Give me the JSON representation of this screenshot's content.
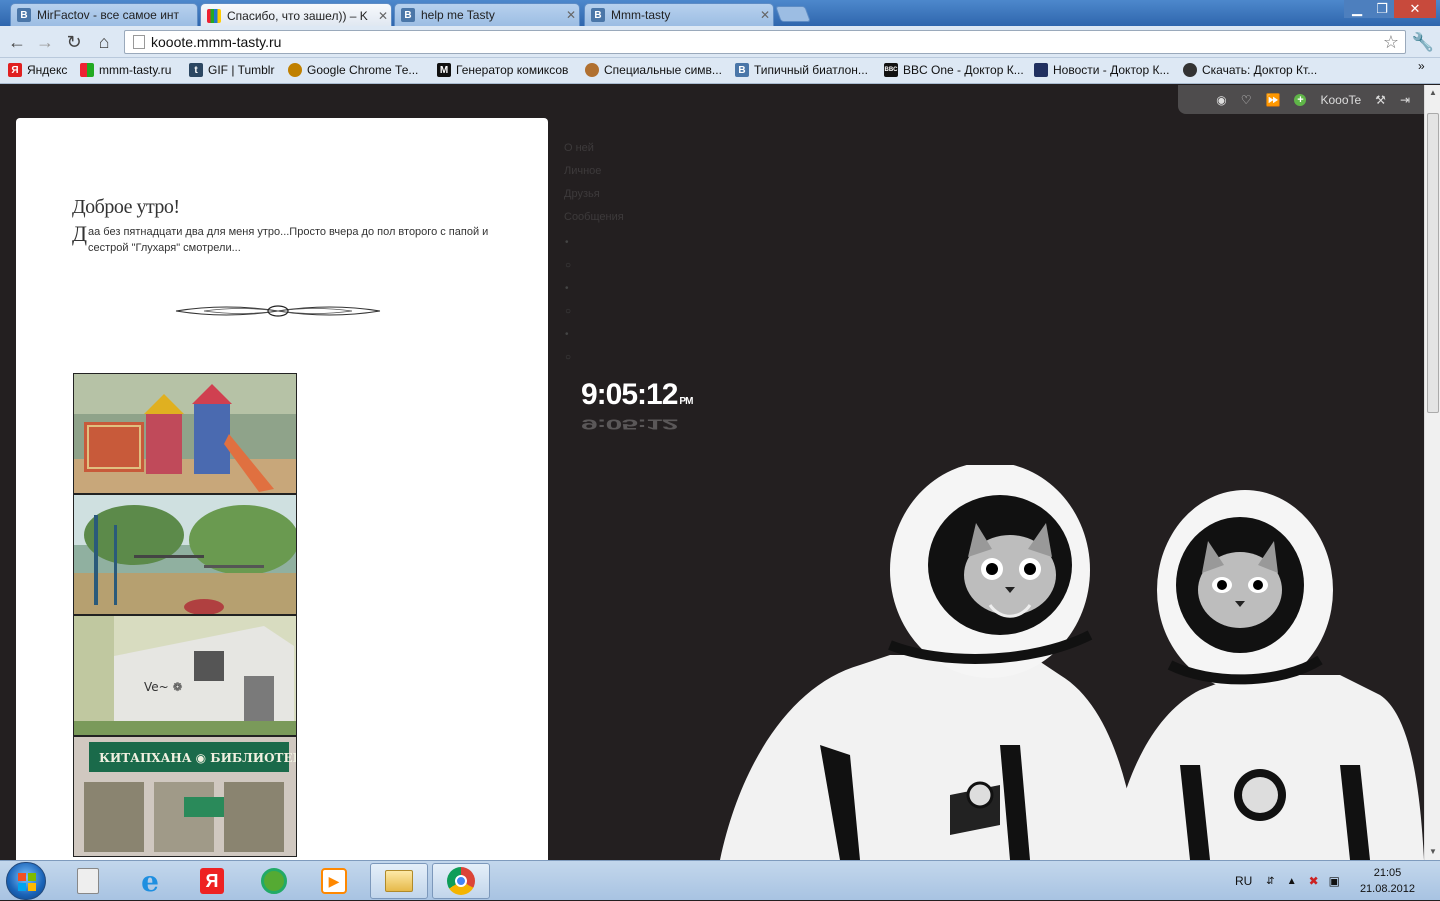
{
  "tabs": [
    {
      "title": "MirFactov - все самое инт",
      "favicon": "B"
    },
    {
      "title": "Спасибо, что зашел)) – K",
      "favicon": ""
    },
    {
      "title": "help me Tasty",
      "favicon": "B"
    },
    {
      "title": "Mmm-tasty",
      "favicon": "B"
    }
  ],
  "address": {
    "url": "kooote.mmm-tasty.ru"
  },
  "bookmarks": [
    {
      "label": "Яндекс",
      "icon": "Я",
      "color": "#e02020"
    },
    {
      "label": "mmm-tasty.ru",
      "icon": "",
      "color": "#f0b000"
    },
    {
      "label": "GIF | Tumblr",
      "icon": "t",
      "color": "#2c4762"
    },
    {
      "label": "Google Chrome Те...",
      "icon": "",
      "color": "#c08000"
    },
    {
      "label": "Генератор комиксов",
      "icon": "M",
      "color": "#111111"
    },
    {
      "label": "Специальные симв...",
      "icon": "",
      "color": "#b07030"
    },
    {
      "label": "Типичный биатлон...",
      "icon": "B",
      "color": "#4a76a8"
    },
    {
      "label": "BBC One - Доктор К...",
      "icon": "BBC",
      "color": "#111111"
    },
    {
      "label": "Новости - Доктор К...",
      "icon": "",
      "color": "#203060"
    },
    {
      "label": "Скачать: Доктор Кт...",
      "icon": "",
      "color": "#333333"
    }
  ],
  "page": {
    "topbar_user": "KoooTe",
    "post_title": "Доброе утро!",
    "post_drop": "Д",
    "post_text": "аа без пятнадцати два для меня утро...Просто вчера до пол второго с папой и сестрой \"Глухаря\" смотрели...",
    "nav": [
      "О ней",
      "Личное",
      "Друзья",
      "Сообщения"
    ],
    "dots": [
      "•",
      "○",
      "•",
      "○",
      "•",
      "○"
    ],
    "clock_time": "9:05:12",
    "clock_ampm": "PM"
  },
  "taskbar": {
    "lang": "RU",
    "time": "21:05",
    "date": "21.08.2012"
  },
  "colors": {
    "page_bg": "#231f20",
    "card_bg": "#ffffff",
    "titlebar": "#3a73b8"
  }
}
